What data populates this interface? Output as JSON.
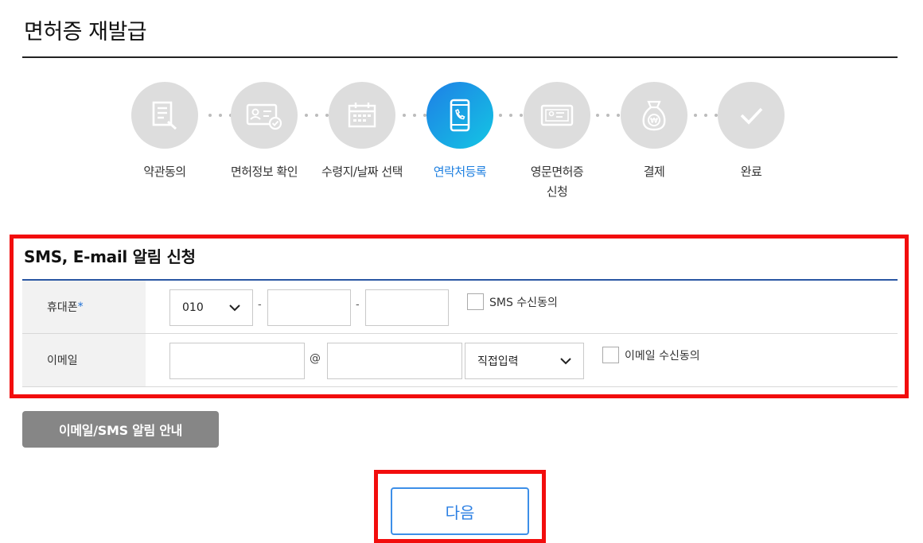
{
  "page": {
    "title": "면허증 재발급"
  },
  "steps": [
    {
      "label": "약관동의",
      "icon": "document-pen-icon",
      "active": false
    },
    {
      "label": "면허정보 확인",
      "icon": "id-card-check-icon",
      "active": false
    },
    {
      "label": "수령지/날짜 선택",
      "icon": "calendar-icon",
      "active": false
    },
    {
      "label": "연락처등록",
      "icon": "phone-icon",
      "active": true
    },
    {
      "label": "영문면허증\n신청",
      "icon": "id-card-icon",
      "active": false
    },
    {
      "label": "결제",
      "icon": "money-bag-won-icon",
      "active": false
    },
    {
      "label": "완료",
      "icon": "check-icon",
      "active": false
    }
  ],
  "form": {
    "section_title": "SMS, E-mail 알림 신청",
    "phone": {
      "label": "휴대폰",
      "required_mark": "*",
      "prefix_value": "010",
      "sep1": "-",
      "sep2": "-",
      "middle_value": "",
      "last_value": "",
      "consent_label": "SMS 수신동의"
    },
    "email": {
      "label": "이메일",
      "id_value": "",
      "at": "@",
      "domain_value": "",
      "domain_select": "직접입력",
      "consent_label": "이메일 수신동의"
    }
  },
  "buttons": {
    "guide_label": "이메일/SMS 알림 안내",
    "next_label": "다음"
  },
  "colors": {
    "accent": "#1d7fe0",
    "highlight": "#f20d0d",
    "step_inactive": "#dddddd",
    "guide_button": "#868686"
  }
}
